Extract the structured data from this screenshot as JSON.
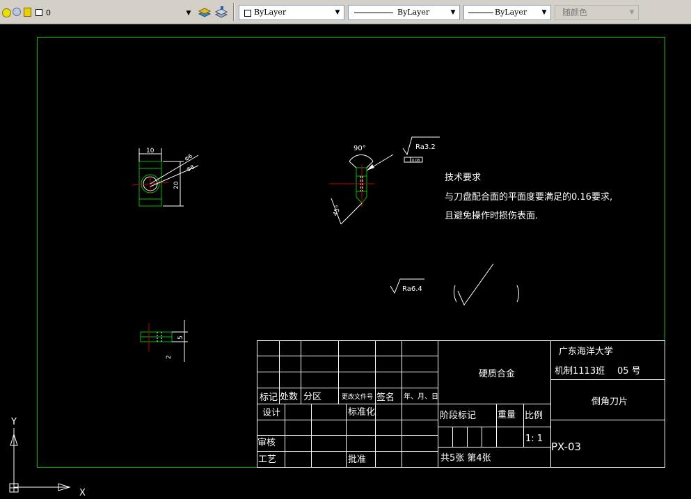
{
  "toolbar": {
    "layer": {
      "value": "0"
    },
    "color": {
      "value": "ByLayer"
    },
    "linetype": {
      "value": "ByLayer"
    },
    "lineweight": {
      "value": "ByLayer"
    },
    "plotstyle": {
      "value": "随颜色"
    }
  },
  "drawing": {
    "front_view": {
      "dim_width": "10",
      "dim_height": "20",
      "dim_dia_a": "Φ6",
      "dim_dia_b": "Φ8"
    },
    "side_view": {
      "angle_top": "90°",
      "angle_bottom": "45°",
      "roughness": "Ra3.2",
      "tolerance_tag": "0.08"
    },
    "small_view": {
      "dim_a": "5",
      "dim_b": "2"
    },
    "tech_requirements": {
      "title": "技术要求",
      "line1": "与刀盘配合面的平面度要满足的0.16要求,",
      "line2": "且避免操作时损伤表面."
    },
    "roughness_note": {
      "value": "Ra6.4"
    },
    "title_block": {
      "school": "广东海洋大学",
      "class_label": "机制1113班",
      "number_label": "05  号",
      "material": "硬质合金",
      "part_name": "倒角刀片",
      "drawing_no": "PX-03",
      "mark": "标记",
      "count": "处数",
      "zone": "分区",
      "doc_no": "更改文件号",
      "sign": "签名",
      "date": "年、月、日",
      "design": "设计",
      "standard": "标准化",
      "stage_mark": "阶段标记",
      "weight": "重量",
      "scale": "比例",
      "scale_value": "1: 1",
      "review": "审核",
      "process": "工艺",
      "approve": "批准",
      "sheets": "共5张   第4张"
    }
  },
  "ucs": {
    "y": "Y",
    "x": "X"
  },
  "colors": {
    "border": "#00c000",
    "lines": "#ffffff",
    "center": "#c00000",
    "background": "#000000"
  }
}
